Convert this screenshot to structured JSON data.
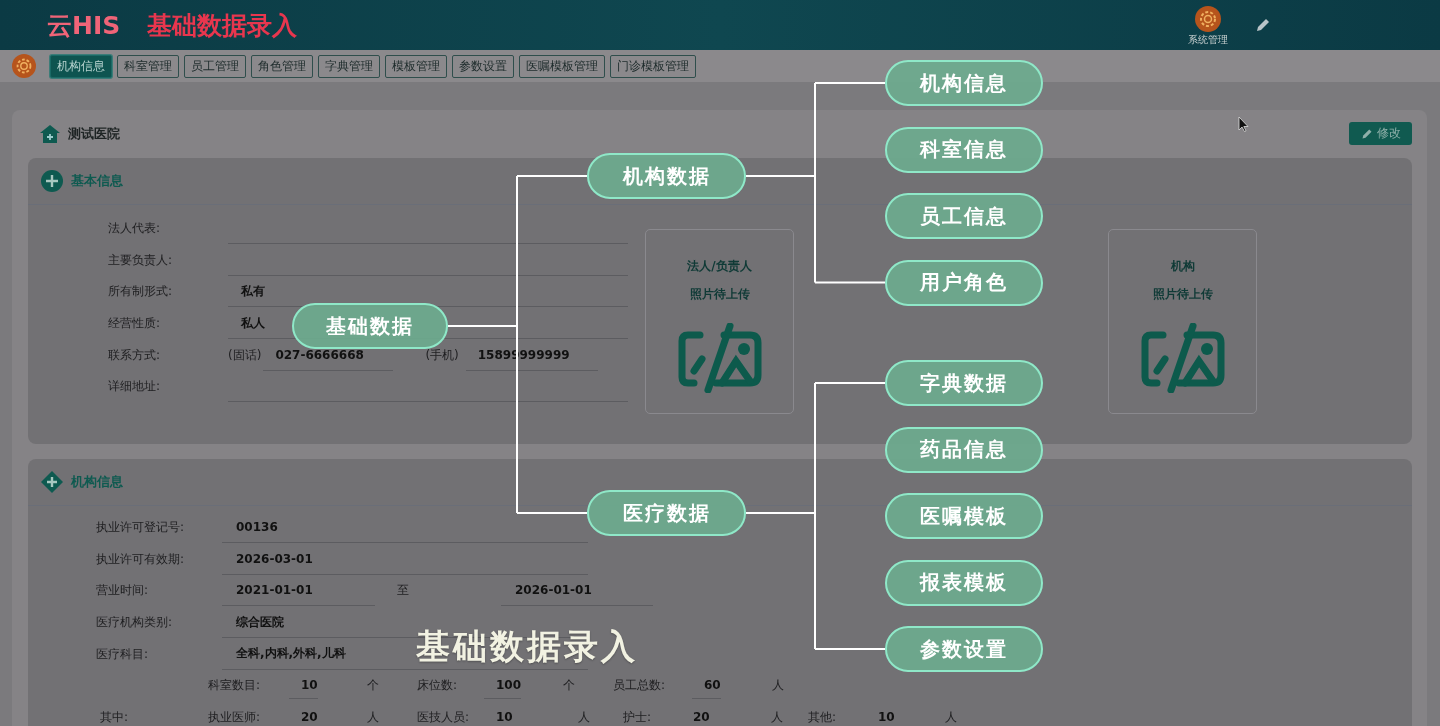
{
  "header": {
    "logo": "云HIS",
    "title": "基础数据录入",
    "system_label": "系统管理"
  },
  "tabs": [
    {
      "label": "机构信息",
      "selected": true
    },
    {
      "label": "科室管理",
      "selected": false
    },
    {
      "label": "员工管理",
      "selected": false
    },
    {
      "label": "角色管理",
      "selected": false
    },
    {
      "label": "字典管理",
      "selected": false
    },
    {
      "label": "模板管理",
      "selected": false
    },
    {
      "label": "参数设置",
      "selected": false
    },
    {
      "label": "医嘱模板管理",
      "selected": false
    },
    {
      "label": "门诊模板管理",
      "selected": false
    }
  ],
  "hospital": {
    "name": "测试医院",
    "edit_button": "修改"
  },
  "basic_info": {
    "title": "基本信息",
    "rows": [
      {
        "kind": "field",
        "label": "法人代表:"
      },
      {
        "kind": "field",
        "label": "主要负责人:"
      },
      {
        "kind": "field",
        "label": "所有制形式:",
        "value": "私有"
      },
      {
        "kind": "field",
        "label": "经营性质:",
        "value": "私人"
      },
      {
        "kind": "contact",
        "label": "联系方式:",
        "parts": [
          {
            "prefix": "(固话)",
            "value": "027-6666668"
          },
          {
            "prefix": "(手机)",
            "value": "15899999999"
          }
        ]
      },
      {
        "kind": "field",
        "label": "详细地址:"
      }
    ],
    "photos": [
      {
        "line1": "法人/负责人",
        "line2": "照片待上传"
      },
      {
        "line1": "机构",
        "line2": "照片待上传"
      }
    ]
  },
  "org_info": {
    "title": "机构信息",
    "rows": [
      {
        "kind": "field",
        "label": "执业许可登记号:",
        "value": "00136"
      },
      {
        "kind": "field",
        "label": "执业许可有效期:",
        "value": "2026-03-01"
      },
      {
        "kind": "range",
        "label": "营业时间:",
        "value": "2021-01-01",
        "separator": "至",
        "value_to": "2026-01-01"
      },
      {
        "kind": "field",
        "label": "医疗机构类别:",
        "value": "综合医院"
      },
      {
        "kind": "field",
        "label": "医疗科目:",
        "value": "全科,内科,外科,儿科"
      }
    ],
    "counts": [
      {
        "label": "科室数目:",
        "value": "10",
        "unit": "个"
      },
      {
        "label": "床位数:",
        "value": "100",
        "unit": "个"
      },
      {
        "label": "员工总数:",
        "value": "60",
        "unit": "人"
      }
    ],
    "staff_prefix": "其中:",
    "staff": [
      {
        "label": "执业医师:",
        "value": "20",
        "unit": "人"
      },
      {
        "label": "医技人员:",
        "value": "10",
        "unit": "人"
      },
      {
        "label": "护士:",
        "value": "20",
        "unit": "人"
      },
      {
        "label": "其他:",
        "value": "10",
        "unit": "人"
      }
    ]
  },
  "mind_map": {
    "root": "基础数据",
    "branches": [
      {
        "label": "机构数据",
        "children": [
          {
            "label": "机构信息"
          },
          {
            "label": "科室信息"
          },
          {
            "label": "员工信息"
          },
          {
            "label": "用户角色"
          }
        ]
      },
      {
        "label": "医疗数据",
        "children": [
          {
            "label": "字典数据"
          },
          {
            "label": "药品信息"
          },
          {
            "label": "医嘱模板"
          },
          {
            "label": "报表模板"
          },
          {
            "label": "参数设置"
          }
        ]
      }
    ]
  },
  "caption": "基础数据录入"
}
